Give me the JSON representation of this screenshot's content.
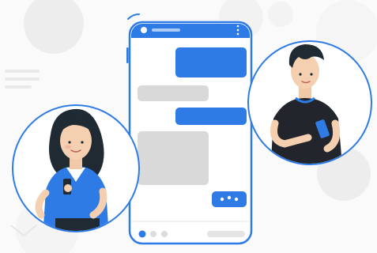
{
  "illustration": {
    "accent_color": "#2e7be6",
    "outline_color": "#2e7be6",
    "bubble_sent_color": "#2e7be6",
    "bubble_received_color": "#d9d9d9",
    "backdrop_color": "#f1f1f1",
    "icons": [
      "smartphone-icon",
      "typing-indicator-icon",
      "kebab-menu-icon"
    ]
  }
}
